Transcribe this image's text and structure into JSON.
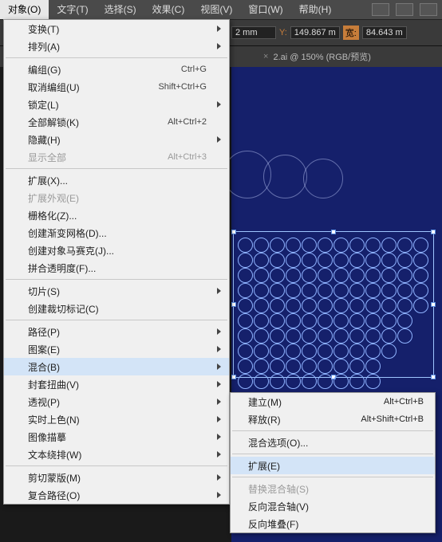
{
  "menubar": {
    "items": [
      "对象(O)",
      "文字(T)",
      "选择(S)",
      "效果(C)",
      "视图(V)",
      "窗口(W)",
      "帮助(H)"
    ],
    "open_index": 0
  },
  "propbar": {
    "x_suffix": "2 mm",
    "y_label": "Y:",
    "y_value": "149.867 m",
    "w_label": "宽:",
    "w_value": "84.643 m"
  },
  "tabbar": {
    "close_glyph": "×",
    "active_tab": "2.ai @ 150% (RGB/预览)"
  },
  "menu1": {
    "groups": [
      [
        {
          "label": "变换(T)",
          "sub": true
        },
        {
          "label": "排列(A)",
          "sub": true
        }
      ],
      [
        {
          "label": "编组(G)",
          "shortcut": "Ctrl+G"
        },
        {
          "label": "取消编组(U)",
          "shortcut": "Shift+Ctrl+G"
        },
        {
          "label": "锁定(L)",
          "sub": true
        },
        {
          "label": "全部解锁(K)",
          "shortcut": "Alt+Ctrl+2"
        },
        {
          "label": "隐藏(H)",
          "sub": true
        },
        {
          "label": "显示全部",
          "shortcut": "Alt+Ctrl+3",
          "disabled": true
        }
      ],
      [
        {
          "label": "扩展(X)..."
        },
        {
          "label": "扩展外观(E)",
          "disabled": true
        },
        {
          "label": "栅格化(Z)..."
        },
        {
          "label": "创建渐变网格(D)..."
        },
        {
          "label": "创建对象马赛克(J)..."
        },
        {
          "label": "拼合透明度(F)..."
        }
      ],
      [
        {
          "label": "切片(S)",
          "sub": true
        },
        {
          "label": "创建裁切标记(C)"
        }
      ],
      [
        {
          "label": "路径(P)",
          "sub": true
        },
        {
          "label": "图案(E)",
          "sub": true
        },
        {
          "label": "混合(B)",
          "sub": true,
          "highlight": true
        },
        {
          "label": "封套扭曲(V)",
          "sub": true
        },
        {
          "label": "透视(P)",
          "sub": true
        },
        {
          "label": "实时上色(N)",
          "sub": true
        },
        {
          "label": "图像描摹",
          "sub": true
        },
        {
          "label": "文本绕排(W)",
          "sub": true
        }
      ],
      [
        {
          "label": "剪切蒙版(M)",
          "sub": true
        },
        {
          "label": "复合路径(O)",
          "sub": true
        }
      ]
    ]
  },
  "menu2": {
    "groups": [
      [
        {
          "label": "建立(M)",
          "shortcut": "Alt+Ctrl+B"
        },
        {
          "label": "释放(R)",
          "shortcut": "Alt+Shift+Ctrl+B"
        }
      ],
      [
        {
          "label": "混合选项(O)..."
        }
      ],
      [
        {
          "label": "扩展(E)",
          "highlight": true
        }
      ],
      [
        {
          "label": "替换混合轴(S)",
          "disabled": true
        },
        {
          "label": "反向混合轴(V)"
        },
        {
          "label": "反向堆叠(F)"
        }
      ]
    ]
  }
}
